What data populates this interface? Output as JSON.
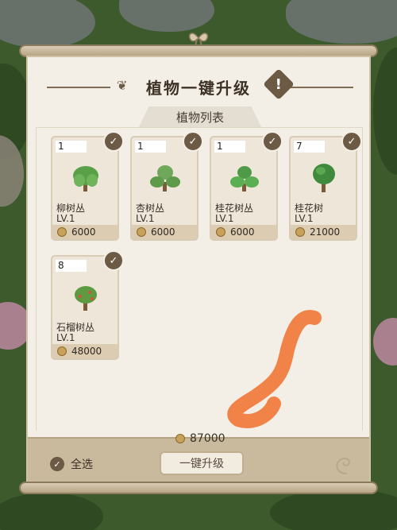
{
  "title": "植物一键升级",
  "list_header": "植物列表",
  "plants": [
    {
      "qty": "1",
      "name": "柳树丛",
      "level": "LV.1",
      "cost": "6000"
    },
    {
      "qty": "1",
      "name": "杏树丛",
      "level": "LV.1",
      "cost": "6000"
    },
    {
      "qty": "1",
      "name": "桂花树丛",
      "level": "LV.1",
      "cost": "6000"
    },
    {
      "qty": "7",
      "name": "桂花树",
      "level": "LV.1",
      "cost": "21000"
    },
    {
      "qty": "8",
      "name": "石榴树丛",
      "level": "LV.1",
      "cost": "48000"
    }
  ],
  "total_cost": "87000",
  "select_all_label": "全选",
  "upgrade_button_label": "一键升级",
  "colors": {
    "panel": "#f4efe6",
    "accent": "#6d5a45",
    "annotation": "#f07a3c"
  }
}
